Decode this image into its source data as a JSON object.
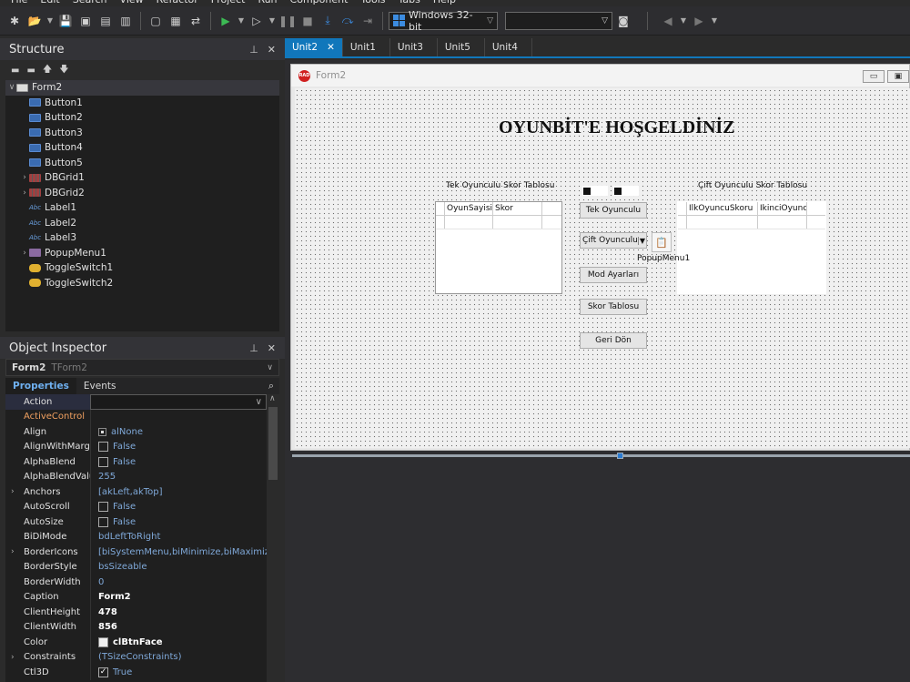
{
  "menubar": [
    "File",
    "Edit",
    "Search",
    "View",
    "Refactor",
    "Project",
    "Run",
    "Component",
    "Tools",
    "Tabs",
    "Help"
  ],
  "toolbar": {
    "platform": "Windows 32-bit",
    "config": ""
  },
  "structure": {
    "title": "Structure",
    "items": [
      {
        "label": "Form2",
        "icon": "form-icon",
        "expander": "expanded",
        "indent": 0
      },
      {
        "label": "Button1",
        "icon": "button-icon",
        "expander": "",
        "indent": 1
      },
      {
        "label": "Button2",
        "icon": "button-icon",
        "expander": "",
        "indent": 1
      },
      {
        "label": "Button3",
        "icon": "button-icon",
        "expander": "",
        "indent": 1
      },
      {
        "label": "Button4",
        "icon": "button-icon",
        "expander": "",
        "indent": 1
      },
      {
        "label": "Button5",
        "icon": "button-icon",
        "expander": "",
        "indent": 1
      },
      {
        "label": "DBGrid1",
        "icon": "grid-icon",
        "expander": "collapsed",
        "indent": 1
      },
      {
        "label": "DBGrid2",
        "icon": "grid-icon",
        "expander": "collapsed",
        "indent": 1
      },
      {
        "label": "Label1",
        "icon": "label-icon",
        "expander": "",
        "indent": 1
      },
      {
        "label": "Label2",
        "icon": "label-icon",
        "expander": "",
        "indent": 1
      },
      {
        "label": "Label3",
        "icon": "label-icon",
        "expander": "",
        "indent": 1
      },
      {
        "label": "PopupMenu1",
        "icon": "popupmenu-icon",
        "expander": "collapsed",
        "indent": 1
      },
      {
        "label": "ToggleSwitch1",
        "icon": "toggle-icon",
        "expander": "",
        "indent": 1
      },
      {
        "label": "ToggleSwitch2",
        "icon": "toggle-icon",
        "expander": "",
        "indent": 1
      }
    ]
  },
  "inspector": {
    "title": "Object Inspector",
    "selected_name": "Form2",
    "selected_class": "TForm2",
    "tab_properties": "Properties",
    "tab_events": "Events",
    "props": [
      {
        "name": "Action",
        "value": "",
        "kind": "edit",
        "expander": false,
        "orange": false
      },
      {
        "name": "ActiveControl",
        "value": "",
        "kind": "text",
        "expander": false,
        "orange": true
      },
      {
        "name": "Align",
        "value": "alNone",
        "kind": "radio",
        "expander": false,
        "orange": false
      },
      {
        "name": "AlignWithMargins",
        "value": "False",
        "kind": "check",
        "checked": false,
        "expander": false,
        "orange": false
      },
      {
        "name": "AlphaBlend",
        "value": "False",
        "kind": "check",
        "checked": false,
        "expander": false,
        "orange": false
      },
      {
        "name": "AlphaBlendValue",
        "value": "255",
        "kind": "text",
        "expander": false,
        "orange": false
      },
      {
        "name": "Anchors",
        "value": "[akLeft,akTop]",
        "kind": "text",
        "expander": true,
        "orange": false
      },
      {
        "name": "AutoScroll",
        "value": "False",
        "kind": "check",
        "checked": false,
        "expander": false,
        "orange": false
      },
      {
        "name": "AutoSize",
        "value": "False",
        "kind": "check",
        "checked": false,
        "expander": false,
        "orange": false
      },
      {
        "name": "BiDiMode",
        "value": "bdLeftToRight",
        "kind": "text",
        "expander": false,
        "orange": false
      },
      {
        "name": "BorderIcons",
        "value": "[biSystemMenu,biMinimize,biMaximize]",
        "kind": "text",
        "expander": true,
        "orange": false
      },
      {
        "name": "BorderStyle",
        "value": "bsSizeable",
        "kind": "text",
        "expander": false,
        "orange": false
      },
      {
        "name": "BorderWidth",
        "value": "0",
        "kind": "text",
        "expander": false,
        "orange": false
      },
      {
        "name": "Caption",
        "value": "Form2",
        "kind": "bold",
        "expander": false,
        "orange": false
      },
      {
        "name": "ClientHeight",
        "value": "478",
        "kind": "bold",
        "expander": false,
        "orange": false
      },
      {
        "name": "ClientWidth",
        "value": "856",
        "kind": "bold",
        "expander": false,
        "orange": false
      },
      {
        "name": "Color",
        "value": "clBtnFace",
        "kind": "color",
        "expander": false,
        "orange": false
      },
      {
        "name": "Constraints",
        "value": "(TSizeConstraints)",
        "kind": "text",
        "expander": true,
        "orange": false
      },
      {
        "name": "Ctl3D",
        "value": "True",
        "kind": "check",
        "checked": true,
        "expander": false,
        "orange": false
      }
    ]
  },
  "editor_tabs": [
    {
      "label": "Unit2",
      "active": true,
      "closable": true
    },
    {
      "label": "Unit1",
      "active": false,
      "closable": false
    },
    {
      "label": "Unit3",
      "active": false,
      "closable": false
    },
    {
      "label": "Unit5",
      "active": false,
      "closable": false
    },
    {
      "label": "Unit4",
      "active": false,
      "closable": false
    }
  ],
  "form": {
    "caption": "Form2",
    "heading": "OYUNBİT'E HOŞGELDİNİZ",
    "label_single": "Tek Oyunculu Skor Tablosu",
    "label_double": "Çift Oyunculu Skor Tablosu",
    "grid1_cols": [
      "OyunSayisi",
      "Skor"
    ],
    "grid2_cols": [
      "IlkOyuncuSkoru",
      "IkinciOyuncu"
    ],
    "btn_single": "Tek Oyunculu",
    "btn_double": "Çift Oyunculu",
    "btn_mode": "Mod Ayarları",
    "btn_score": "Skor Tablosu",
    "btn_back": "Geri Dön",
    "popup_label": "PopupMenu1"
  },
  "colors": {
    "accent": "#1177bb",
    "orange_prop": "#f0a060"
  }
}
